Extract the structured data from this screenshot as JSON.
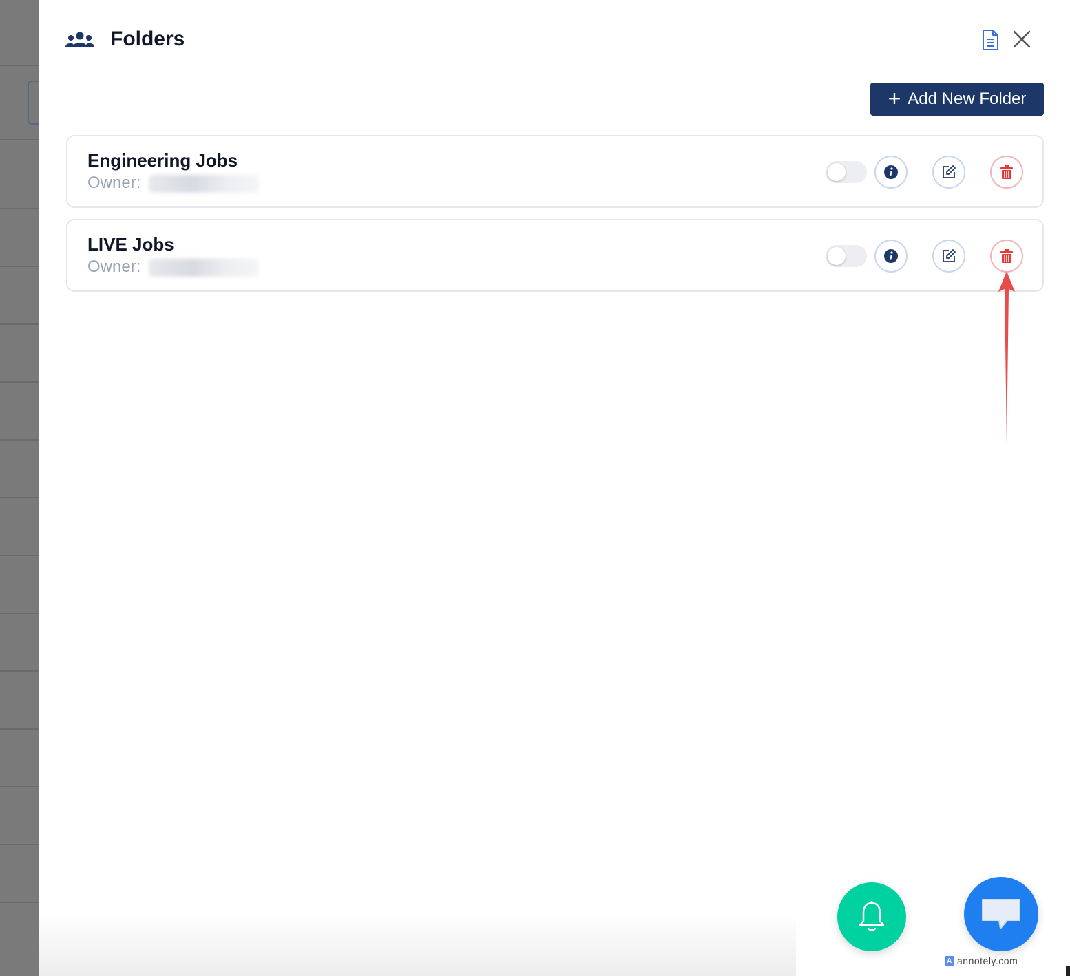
{
  "header": {
    "title": "Folders",
    "icons": [
      "users-icon",
      "document-icon",
      "close-icon"
    ]
  },
  "toolbar": {
    "add_folder_label": "Add New Folder",
    "add_icon": "+"
  },
  "folders": [
    {
      "name": "Engineering Jobs",
      "owner_label": "Owner:",
      "enabled": false
    },
    {
      "name": "LIVE Jobs",
      "owner_label": "Owner:",
      "enabled": false
    }
  ],
  "colors": {
    "primary": "#1d3868",
    "danger": "#e53935",
    "bell_fab": "#00d1a0",
    "chat_fab": "#1f7ef0",
    "annotation_arrow": "#e84b4b"
  },
  "floating_actions": [
    "bell-icon",
    "chat-icon"
  ],
  "watermark": "annotely.com"
}
